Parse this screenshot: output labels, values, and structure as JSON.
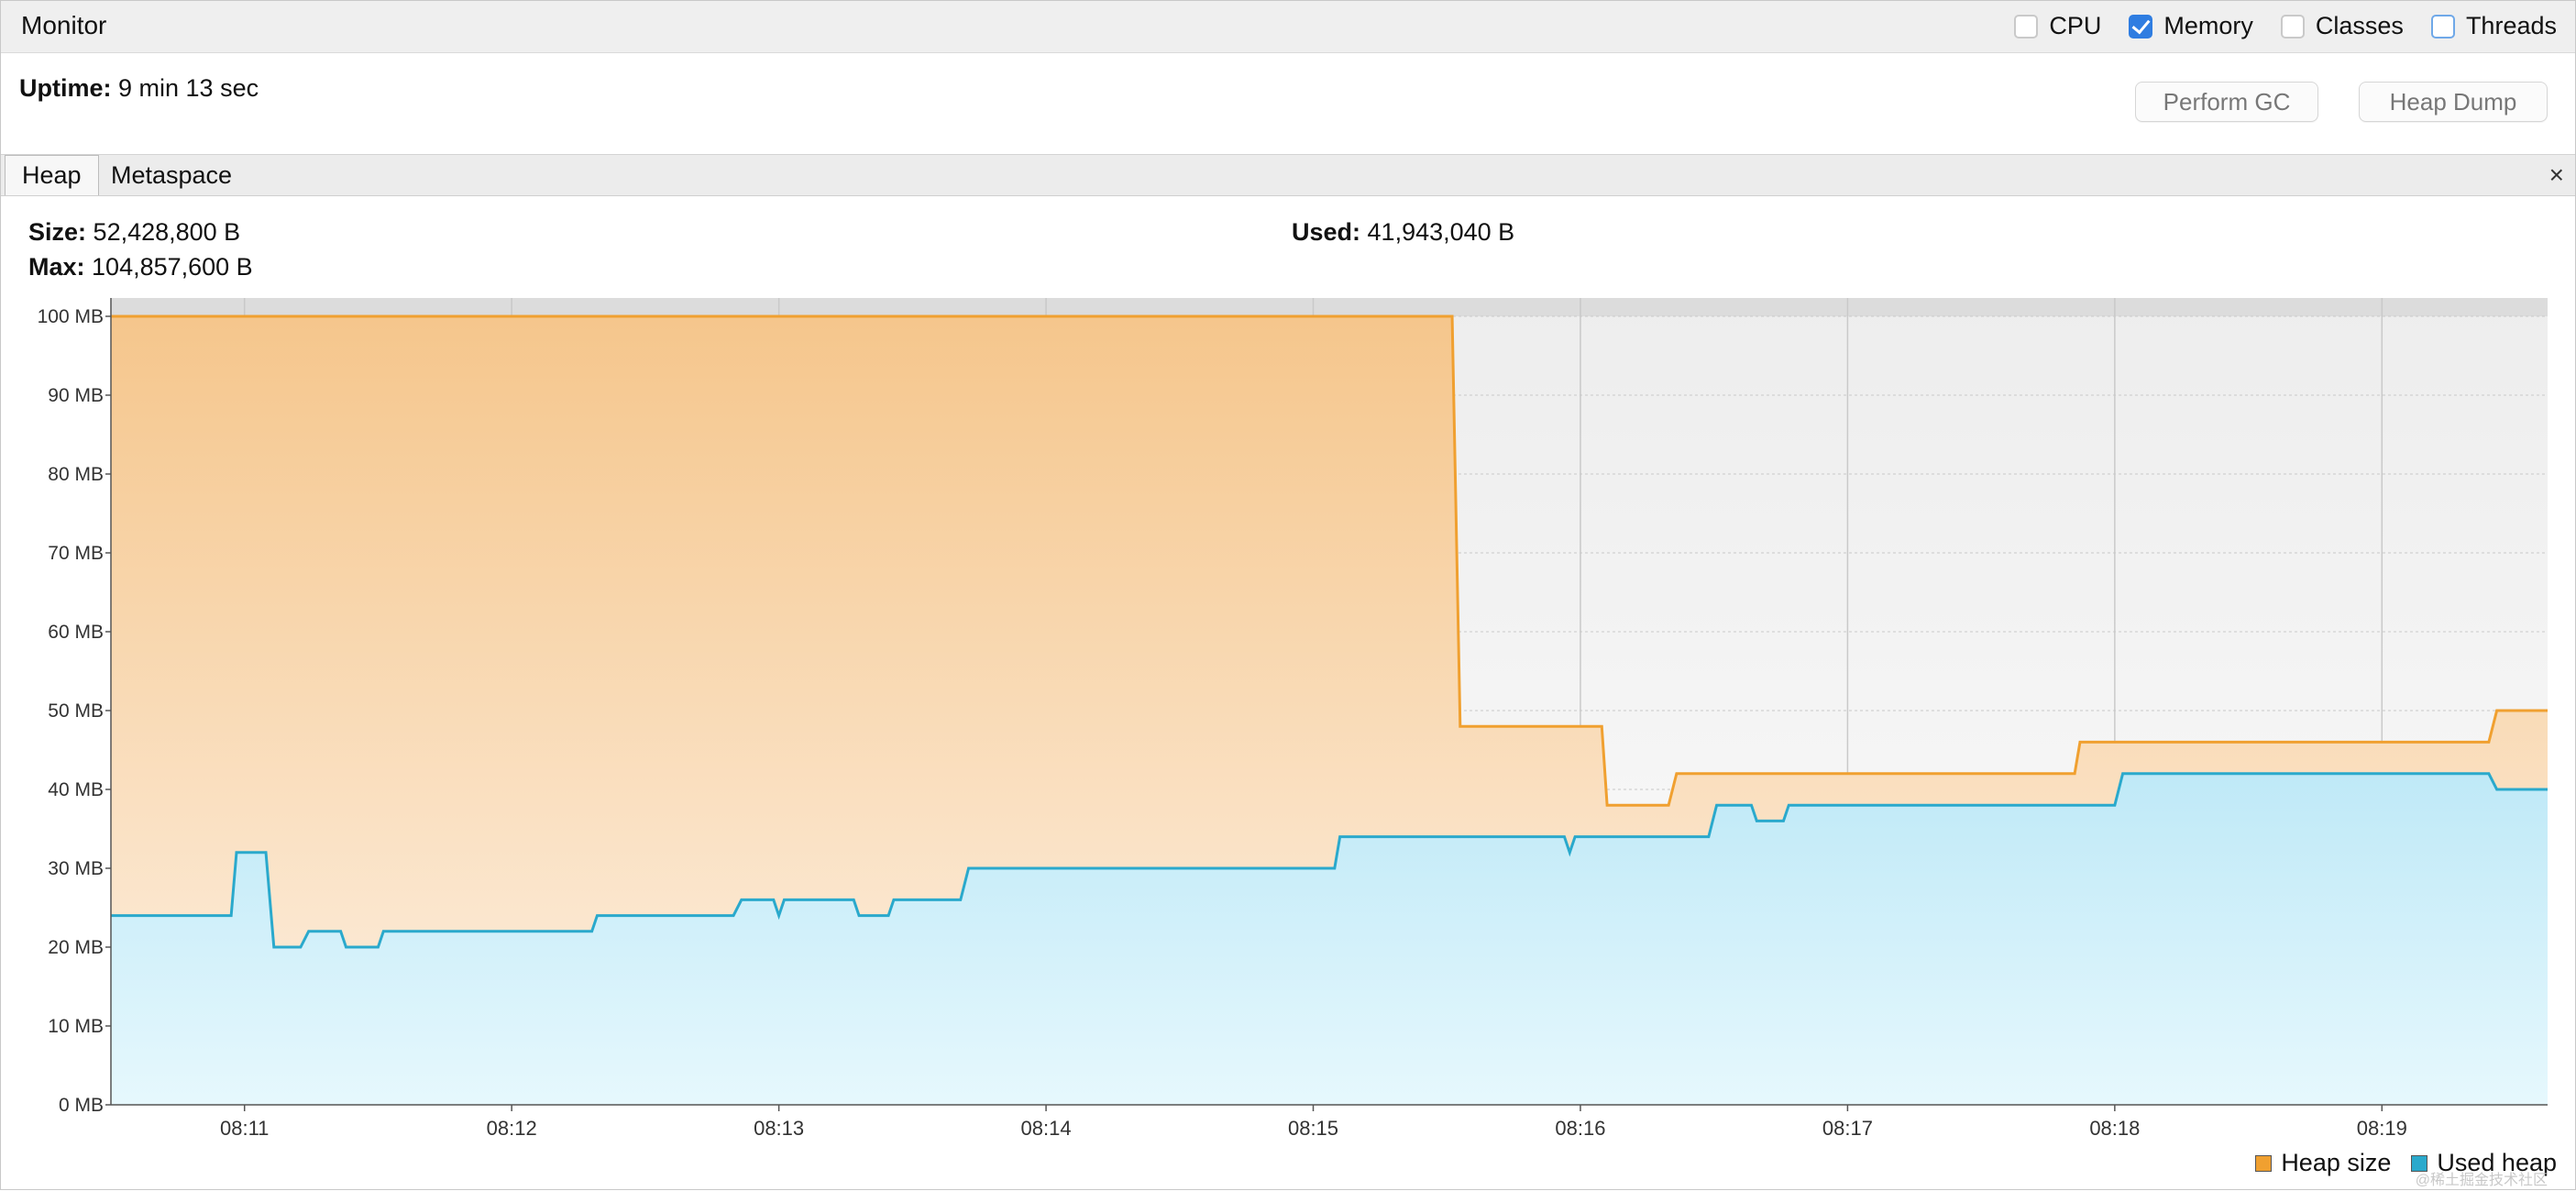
{
  "header": {
    "title": "Monitor",
    "toggles": [
      {
        "label": "CPU",
        "checked": false
      },
      {
        "label": "Memory",
        "checked": true
      },
      {
        "label": "Classes",
        "checked": false
      },
      {
        "label": "Threads",
        "checked": false
      }
    ]
  },
  "uptime": {
    "label": "Uptime:",
    "value": "9 min 13 sec"
  },
  "buttons": {
    "perform_gc": "Perform GC",
    "heap_dump": "Heap Dump"
  },
  "tabs": {
    "heap": "Heap",
    "metaspace": "Metaspace",
    "close": "×"
  },
  "stats": {
    "size_label": "Size:",
    "size_value": "52,428,800 B",
    "max_label": "Max:",
    "max_value": "104,857,600 B",
    "used_label": "Used:",
    "used_value": "41,943,040 B"
  },
  "legend": {
    "heap_size": "Heap size",
    "used_heap": "Used heap"
  },
  "watermark": "@稀土掘金技术社区",
  "colors": {
    "heap_size": "#f0a030",
    "used_heap": "#2aa9cc"
  },
  "chart_data": {
    "type": "area",
    "title": "",
    "x_unit": "minutes (time of day 08:xx)",
    "y_unit": "MB",
    "ylim": [
      0,
      100
    ],
    "xlim": [
      10.5,
      19.62
    ],
    "yticks": [
      "0 MB",
      "10 MB",
      "20 MB",
      "30 MB",
      "40 MB",
      "50 MB",
      "60 MB",
      "70 MB",
      "80 MB",
      "90 MB",
      "100 MB"
    ],
    "xticks": [
      {
        "value": 11,
        "label": "08:11"
      },
      {
        "value": 12,
        "label": "08:12"
      },
      {
        "value": 13,
        "label": "08:13"
      },
      {
        "value": 14,
        "label": "08:14"
      },
      {
        "value": 15,
        "label": "08:15"
      },
      {
        "value": 16,
        "label": "08:16"
      },
      {
        "value": 17,
        "label": "08:17"
      },
      {
        "value": 18,
        "label": "08:18"
      },
      {
        "value": 19,
        "label": "08:19"
      }
    ],
    "max_heap_mb": 100,
    "grid": true,
    "legend_position": "bottom-right",
    "series": [
      {
        "name": "Heap size",
        "points": [
          [
            10.5,
            100
          ],
          [
            15.52,
            100
          ],
          [
            15.55,
            48
          ],
          [
            16.08,
            48
          ],
          [
            16.1,
            38
          ],
          [
            16.33,
            38
          ],
          [
            16.36,
            42
          ],
          [
            17.85,
            42
          ],
          [
            17.87,
            46
          ],
          [
            19.4,
            46
          ],
          [
            19.43,
            50
          ],
          [
            19.62,
            50
          ]
        ]
      },
      {
        "name": "Used heap",
        "points": [
          [
            10.5,
            24
          ],
          [
            10.95,
            24
          ],
          [
            10.97,
            32
          ],
          [
            11.08,
            32
          ],
          [
            11.11,
            20
          ],
          [
            11.21,
            20
          ],
          [
            11.24,
            22
          ],
          [
            11.36,
            22
          ],
          [
            11.38,
            20
          ],
          [
            11.5,
            20
          ],
          [
            11.52,
            22
          ],
          [
            12.3,
            22
          ],
          [
            12.32,
            24
          ],
          [
            12.83,
            24
          ],
          [
            12.86,
            26
          ],
          [
            12.98,
            26
          ],
          [
            13.0,
            24
          ],
          [
            13.02,
            26
          ],
          [
            13.28,
            26
          ],
          [
            13.3,
            24
          ],
          [
            13.41,
            24
          ],
          [
            13.43,
            26
          ],
          [
            13.68,
            26
          ],
          [
            13.71,
            30
          ],
          [
            15.08,
            30
          ],
          [
            15.1,
            34
          ],
          [
            15.94,
            34
          ],
          [
            15.96,
            32
          ],
          [
            15.98,
            34
          ],
          [
            16.48,
            34
          ],
          [
            16.51,
            38
          ],
          [
            16.64,
            38
          ],
          [
            16.66,
            36
          ],
          [
            16.76,
            36
          ],
          [
            16.78,
            38
          ],
          [
            18.0,
            38
          ],
          [
            18.03,
            42
          ],
          [
            19.4,
            42
          ],
          [
            19.43,
            40
          ],
          [
            19.62,
            40
          ]
        ]
      }
    ]
  }
}
